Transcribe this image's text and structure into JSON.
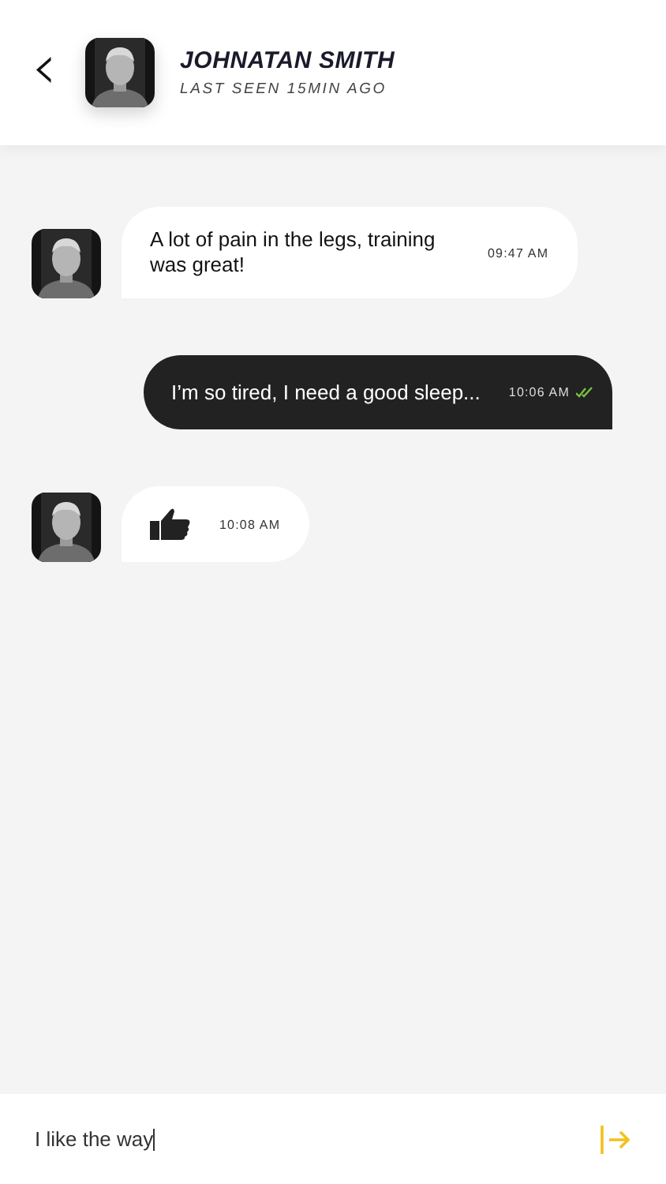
{
  "header": {
    "back": "‹",
    "name": "JOHNATAN SMITH",
    "status": "LAST SEEN 15MIN AGO"
  },
  "messages": [
    {
      "outgoing": false,
      "kind": "text",
      "text": "A lot of pain in the legs, training was great!",
      "time": "09:47 AM"
    },
    {
      "outgoing": true,
      "kind": "text",
      "text": "I’m so tired, I need a good sleep...",
      "time": "10:06 AM",
      "read": true
    },
    {
      "outgoing": false,
      "kind": "thumbs-up",
      "time": "10:08 AM"
    }
  ],
  "composer": {
    "value": "I like the way"
  }
}
